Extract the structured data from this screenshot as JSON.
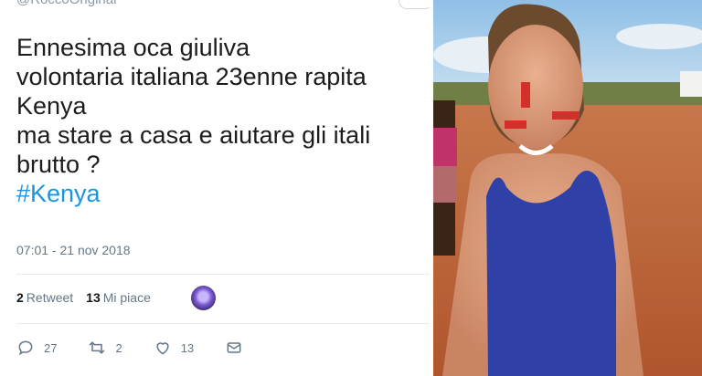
{
  "tweet": {
    "handle": "@RoccoOriginal",
    "lines": [
      "Ennesima oca giuliva",
      "volontaria italiana 23enne rapita",
      "Kenya",
      "ma stare a casa e aiutare gli itali",
      "brutto ?"
    ],
    "hashtag": "#Kenya",
    "timestamp": "07:01 - 21 nov 2018",
    "retweets_count": "2",
    "retweets_label": "Retweet",
    "likes_count": "13",
    "likes_label": "Mi piace",
    "reply_count": "27",
    "retweet_action_count": "2",
    "like_action_count": "13",
    "colors": {
      "link": "#1b95e0",
      "muted": "#657786"
    }
  },
  "icons": [
    "reply-icon",
    "retweet-icon",
    "like-icon",
    "message-icon"
  ],
  "photo": {
    "description_icon": "photo-image"
  }
}
